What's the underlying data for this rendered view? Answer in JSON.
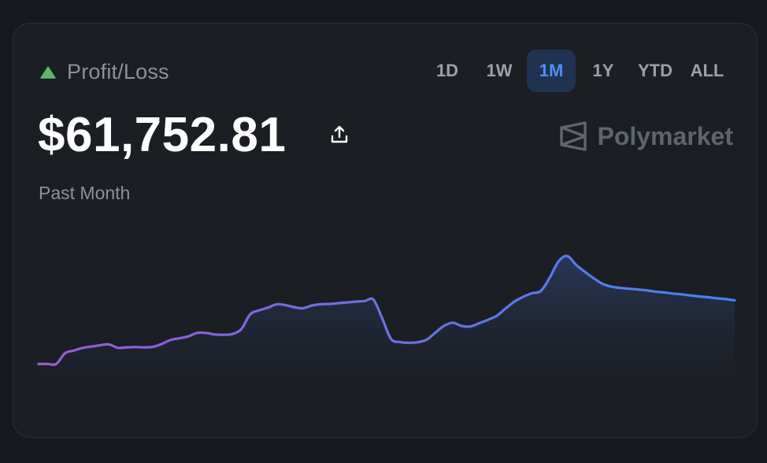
{
  "widget": {
    "title": "Profit/Loss",
    "value": "$61,752.81",
    "period_label": "Past Month",
    "brand": "Polymarket",
    "trend_icon": "triangle-up-icon",
    "trend_color": "#5fb56a",
    "share_icon": "share-upload-icon",
    "brand_icon": "polymarket-logo-icon"
  },
  "tabs": [
    {
      "label": "1D",
      "active": false
    },
    {
      "label": "1W",
      "active": false
    },
    {
      "label": "1M",
      "active": true
    },
    {
      "label": "1Y",
      "active": false
    },
    {
      "label": "YTD",
      "active": false
    },
    {
      "label": "ALL",
      "active": false
    }
  ],
  "colors": {
    "active_tab_bg": "#1f3350",
    "active_tab_text": "#4f8ff0",
    "line_start": "#9a5bd6",
    "line_end": "#3f86ee"
  },
  "chart_data": {
    "type": "area",
    "title": "",
    "xlabel": "",
    "ylabel": "",
    "grid": false,
    "legend": "none",
    "ylim": [
      0,
      100
    ],
    "x": [
      0,
      1,
      2,
      3,
      4,
      5,
      6,
      7,
      8,
      9,
      10,
      11,
      12,
      13,
      14,
      15,
      16,
      17,
      18,
      19,
      20,
      21,
      22,
      23,
      24,
      25,
      26,
      27,
      28,
      29,
      30,
      31,
      32,
      33,
      34,
      35,
      36,
      37,
      38,
      39,
      40,
      41,
      42,
      43,
      44,
      45,
      46,
      47,
      48,
      49,
      50,
      51,
      52,
      53,
      54,
      55,
      56,
      57,
      58,
      59,
      60,
      61,
      62,
      63,
      64,
      65,
      66,
      67,
      68,
      69,
      70,
      71,
      72,
      73,
      74,
      75,
      76,
      77,
      78,
      79
    ],
    "series": [
      {
        "values": [
          17,
          17,
          17,
          21,
          22,
          23,
          23.5,
          24,
          24.3,
          23,
          23.2,
          23.3,
          23.2,
          23.4,
          24.5,
          26,
          26.6,
          27.3,
          28.6,
          28.6,
          28,
          27.9,
          28.2,
          30,
          35.5,
          37,
          38,
          39.3,
          39,
          38.2,
          37.8,
          38.8,
          39.3,
          39.4,
          39.7,
          40,
          40.3,
          40.5,
          41,
          34,
          26.3,
          25.2,
          24.9,
          25.1,
          26,
          28.6,
          31.2,
          32.4,
          31.2,
          31,
          32.2,
          33.5,
          35,
          37.7,
          40.3,
          42.1,
          43.4,
          44.3,
          49.2,
          55.3,
          57.3,
          54,
          51.4,
          49,
          46.9,
          45.9,
          45.4,
          45.1,
          44.8,
          44.5,
          44,
          43.7,
          43.3,
          43,
          42.6,
          42.2,
          41.9,
          41.5,
          41.2,
          40.8
        ]
      }
    ]
  }
}
